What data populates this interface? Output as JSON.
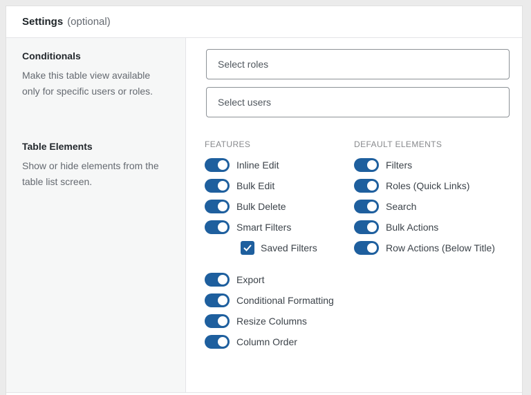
{
  "colors": {
    "accent": "#1e5f9e",
    "page_bg": "#ebebeb"
  },
  "header": {
    "title": "Settings",
    "subtitle": "(optional)"
  },
  "conditionals": {
    "title": "Conditionals",
    "description": "Make this table view available only for specific users or roles.",
    "roles_input": {
      "placeholder": "Select roles"
    },
    "users_input": {
      "placeholder": "Select users"
    }
  },
  "table_elements": {
    "title": "Table Elements",
    "description": "Show or hide elements from the table list screen.",
    "features": {
      "heading": "FEATURES",
      "group1": [
        {
          "label": "Inline Edit",
          "state": "on"
        },
        {
          "label": "Bulk Edit",
          "state": "on"
        },
        {
          "label": "Bulk Delete",
          "state": "on"
        },
        {
          "label": "Smart Filters",
          "state": "on"
        }
      ],
      "saved_filters_checkbox": {
        "label": "Saved Filters",
        "checked": true
      },
      "group2": [
        {
          "label": "Export",
          "state": "on"
        },
        {
          "label": "Conditional Formatting",
          "state": "on"
        },
        {
          "label": "Resize Columns",
          "state": "on"
        },
        {
          "label": "Column Order",
          "state": "on"
        }
      ]
    },
    "default_elements": {
      "heading": "DEFAULT ELEMENTS",
      "toggles": [
        {
          "label": "Filters",
          "state": "on"
        },
        {
          "label": "Roles (Quick Links)",
          "state": "on"
        },
        {
          "label": "Search",
          "state": "on"
        },
        {
          "label": "Bulk Actions",
          "state": "on"
        },
        {
          "label": "Row Actions (Below Title)",
          "state": "on"
        }
      ]
    }
  }
}
